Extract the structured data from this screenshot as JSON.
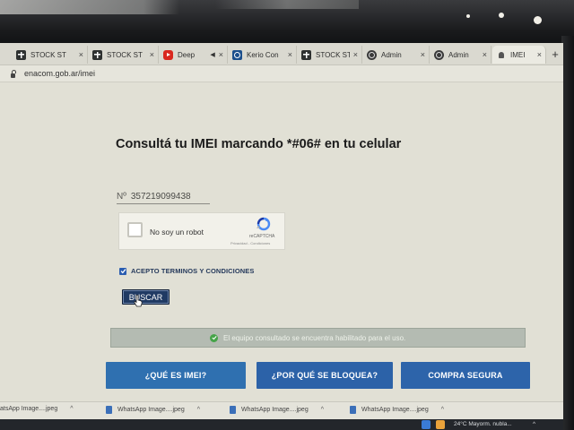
{
  "browser": {
    "tabs": [
      {
        "label": "STOCK ST",
        "icon": "stock-icon"
      },
      {
        "label": "STOCK ST",
        "icon": "stock-icon"
      },
      {
        "label": "Deep",
        "icon": "youtube-icon"
      },
      {
        "label": "Kerio Con",
        "icon": "kerio-icon"
      },
      {
        "label": "STOCK ST",
        "icon": "stock-icon"
      },
      {
        "label": "Admin",
        "icon": "globe-icon"
      },
      {
        "label": "Admin",
        "icon": "globe-icon"
      },
      {
        "label": "IMEI",
        "icon": "bell-icon",
        "active": true
      }
    ],
    "new_tab": "+",
    "close_glyph": "×",
    "url": "enacom.gob.ar/imei"
  },
  "page": {
    "title": "Consultá tu IMEI marcando *#06# en tu celular",
    "imei_prefix": "Nº",
    "imei_value": "357219099438",
    "captcha": {
      "label": "No soy un robot",
      "brand": "reCAPTCHA",
      "terms": "Privacidad - Condiciones"
    },
    "accept_label": "ACEPTO TERMINOS Y CONDICIONES",
    "accept_checked": true,
    "search_button": "BUSCAR",
    "status_message": "El equipo consultado se encuentra habilitado para el uso.",
    "buttons": [
      "¿QUÉ ES IMEI?",
      "¿POR QUÉ SE BLOQUEA?",
      "COMPRA SEGURA"
    ]
  },
  "downloads": [
    "atsApp Image....jpeg",
    "WhatsApp Image....jpeg",
    "WhatsApp Image....jpeg",
    "WhatsApp Image....jpeg"
  ],
  "taskbar": {
    "weather": "24°C  Mayorm. nubla..."
  },
  "colors": {
    "accent_blue": "#2f70b0",
    "search_button": "#203a63",
    "status_bar": "#b4bbb2",
    "ok_green": "#46a449"
  }
}
